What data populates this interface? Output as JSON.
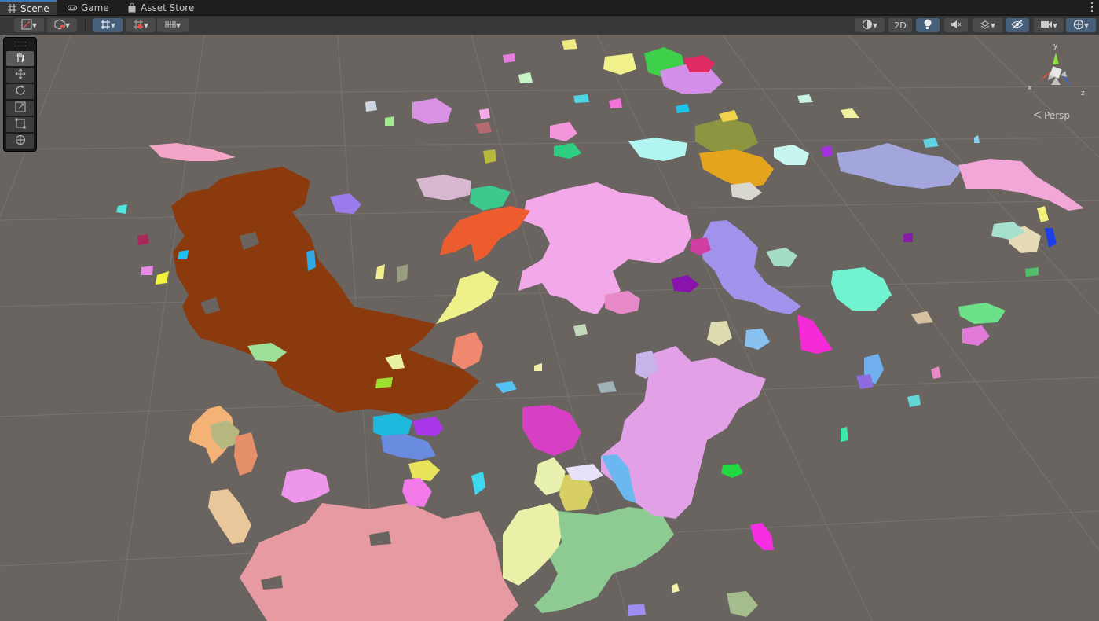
{
  "tabs": [
    {
      "label": "Scene",
      "icon": "grid-icon",
      "active": true
    },
    {
      "label": "Game",
      "icon": "gamepad-icon",
      "active": false
    },
    {
      "label": "Asset Store",
      "icon": "shopping-bag-icon",
      "active": false
    }
  ],
  "toolbar": {
    "mode_2d_label": "2D",
    "tools_left": [
      "transform-tools-icon",
      "draw-mode-icon",
      "grid-snap-icon",
      "increment-snap-icon",
      "ruler-icon"
    ],
    "tools_right": [
      "shading-mode-icon",
      "lighting-icon",
      "audio-mute-icon",
      "effects-icon",
      "hidden-objects-icon",
      "camera-icon",
      "gizmos-icon"
    ]
  },
  "scene_tools": [
    "hand-tool-icon",
    "move-tool-icon",
    "rotate-tool-icon",
    "scale-tool-icon",
    "rect-tool-icon",
    "transform-tool-icon"
  ],
  "gizmo": {
    "x_label": "x",
    "y_label": "y",
    "z_label": "z",
    "projection_label": "Persp"
  },
  "colors": {
    "viewport_bg": "#6a6460",
    "grid": "#7c7672",
    "accent": "#3a79bb"
  }
}
